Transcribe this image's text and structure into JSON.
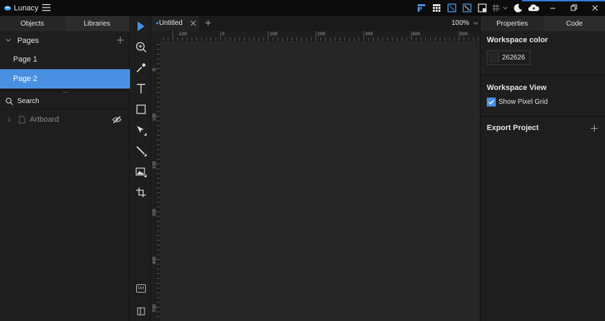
{
  "app": {
    "name": "Lunacy"
  },
  "colors": {
    "accent": "#4a90e2",
    "workspace": "#262626",
    "panel": "#1e1e1e",
    "titlebar": "#0c0c0c"
  },
  "title_bar_icons": [
    "layout-top-icon",
    "layout-grid-icon",
    "frame-icon",
    "frame-alt-icon",
    "panels-icon",
    "pixel-grid-icon",
    "theme-moon-icon",
    "cloud-icon",
    "minimize-icon",
    "restore-icon",
    "close-icon"
  ],
  "left_panel": {
    "tabs": [
      "Objects",
      "Libraries"
    ],
    "pages_header": "Pages",
    "pages": [
      "Page 1",
      "Page 2"
    ],
    "selected_page": "Page 2",
    "splitter_glyph": "...",
    "search_placeholder": "Search",
    "layers": [
      {
        "name": "Artboard",
        "hidden": true
      }
    ]
  },
  "toolbar": {
    "tools": [
      "select-tool-icon",
      "zoom-tool-icon",
      "eyedropper-tool-icon",
      "text-tool-icon",
      "rectangle-tool-icon",
      "pen-tool-icon",
      "line-tool-icon",
      "image-tool-icon",
      "artboard-tool-icon"
    ],
    "bottom": {
      "ctrl_label": "Ctrl"
    }
  },
  "document": {
    "tab_title": "Untitled",
    "zoom": "100%"
  },
  "rulers": {
    "horizontal_labels": [
      "-100",
      "0",
      "100",
      "200",
      "300",
      "400",
      "500"
    ],
    "vertical_labels": [
      "0",
      "100",
      "200",
      "300",
      "400",
      "500"
    ]
  },
  "right_panel": {
    "tabs": [
      "Properties",
      "Code"
    ],
    "workspace_color_title": "Workspace color",
    "workspace_color_value": "262626",
    "workspace_view_title": "Workspace View",
    "show_pixel_grid_label": "Show Pixel Grid",
    "show_pixel_grid_checked": true,
    "export_title": "Export Project"
  }
}
